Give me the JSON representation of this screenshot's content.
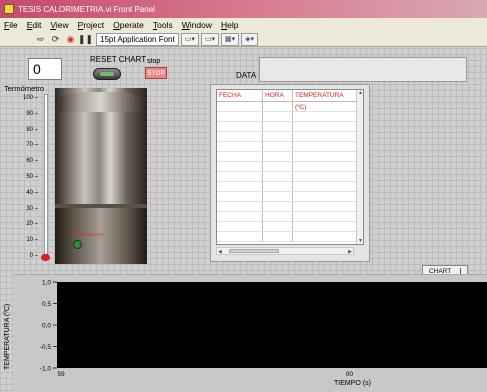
{
  "window": {
    "title": "TESIS CALORIMETRIA.vi Front Panel"
  },
  "menu": [
    "File",
    "Edit",
    "View",
    "Project",
    "Operate",
    "Tools",
    "Window",
    "Help"
  ],
  "toolbar": {
    "font": "15pt Application Font"
  },
  "indicators": {
    "numeric_value": "0",
    "reset_chart_label": "RESET CHART",
    "stop_label": "stop",
    "stop_button": "STOP",
    "data_label": "DATA"
  },
  "thermometer": {
    "label": "Termómetro",
    "ticks": [
      "100",
      "90",
      "80",
      "70",
      "60",
      "50",
      "40",
      "30",
      "20",
      "10",
      "0"
    ],
    "value_fraction": 0,
    "fill_color": "#d42020"
  },
  "photo": {
    "label": "TERMOMETRO"
  },
  "table": {
    "headers": [
      "FECHA",
      "HORA",
      "TEMPERATURA (ºC)"
    ],
    "header_color": "#d02020",
    "rows": 14
  },
  "chart_button": "CHART",
  "chart_data": {
    "type": "line",
    "title": "",
    "xlabel": "TIEMPO (s)",
    "ylabel": "TEMPERATURA (ºC)",
    "y_ticks": [
      "1,0",
      "0,5",
      "0,0",
      "-0,5",
      "-1,0"
    ],
    "ylim": [
      -1.0,
      1.0
    ],
    "x_ticks": [
      "59",
      "00"
    ],
    "series": [],
    "plot_background": "#000000",
    "grid": false
  }
}
